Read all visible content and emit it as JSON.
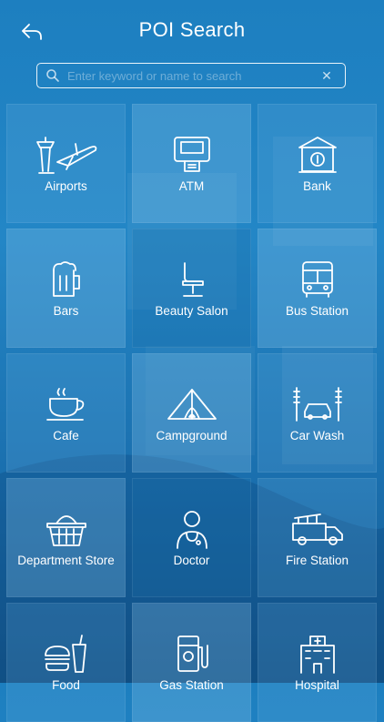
{
  "header": {
    "title": "POI Search"
  },
  "search": {
    "placeholder": "Enter keyword or name to search",
    "value": ""
  },
  "categories": [
    {
      "label": "Airports",
      "icon": "airport-icon"
    },
    {
      "label": "ATM",
      "icon": "atm-icon"
    },
    {
      "label": "Bank",
      "icon": "bank-icon"
    },
    {
      "label": "Bars",
      "icon": "beer-mug-icon"
    },
    {
      "label": "Beauty Salon",
      "icon": "salon-chair-icon"
    },
    {
      "label": "Bus Station",
      "icon": "bus-icon"
    },
    {
      "label": "Cafe",
      "icon": "coffee-cup-icon"
    },
    {
      "label": "Campground",
      "icon": "tent-icon"
    },
    {
      "label": "Car Wash",
      "icon": "car-wash-icon"
    },
    {
      "label": "Department Store",
      "icon": "basket-icon"
    },
    {
      "label": "Doctor",
      "icon": "doctor-icon"
    },
    {
      "label": "Fire Station",
      "icon": "fire-truck-icon"
    },
    {
      "label": "Food",
      "icon": "burger-drink-icon"
    },
    {
      "label": "Gas Station",
      "icon": "gas-pump-icon"
    },
    {
      "label": "Hospital",
      "icon": "hospital-icon"
    }
  ]
}
